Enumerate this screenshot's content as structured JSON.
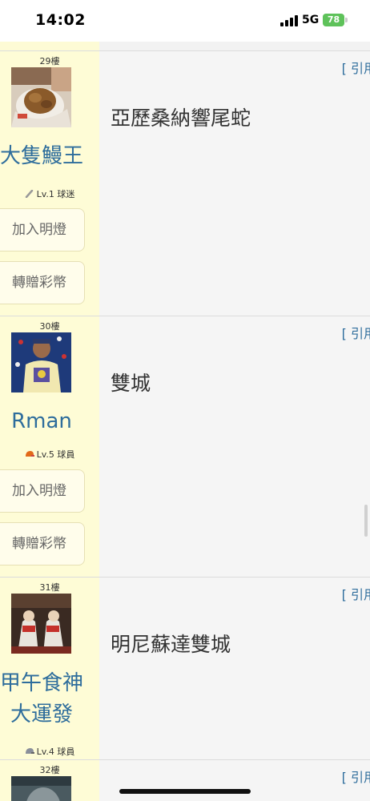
{
  "status_bar": {
    "time": "14:02",
    "network": "5G",
    "battery": "78"
  },
  "posts": [
    {
      "floor": "29樓",
      "username": "大隻鰻王",
      "level": "Lv.1 球迷",
      "follow_label": "加入明燈",
      "gift_label": "轉贈彩幣",
      "quote_label": "[ 引用",
      "text": "亞歷桑納響尾蛇"
    },
    {
      "floor": "30樓",
      "username": "Rman",
      "level": "Lv.5 球員",
      "follow_label": "加入明燈",
      "gift_label": "轉贈彩幣",
      "quote_label": "[ 引用",
      "text": "雙城"
    },
    {
      "floor": "31樓",
      "username_line1": "甲午食神",
      "username_line2": "大運發",
      "level": "Lv.4 球員",
      "quote_label": "[ 引用",
      "text": "明尼蘇達雙城"
    },
    {
      "floor": "32樓",
      "quote_label": "[ 引用"
    }
  ],
  "colors": {
    "sidebar_bg": "#fefcd6",
    "content_bg": "#f5f5f5",
    "username": "#2e6d9c",
    "battery": "#5ec25a"
  }
}
